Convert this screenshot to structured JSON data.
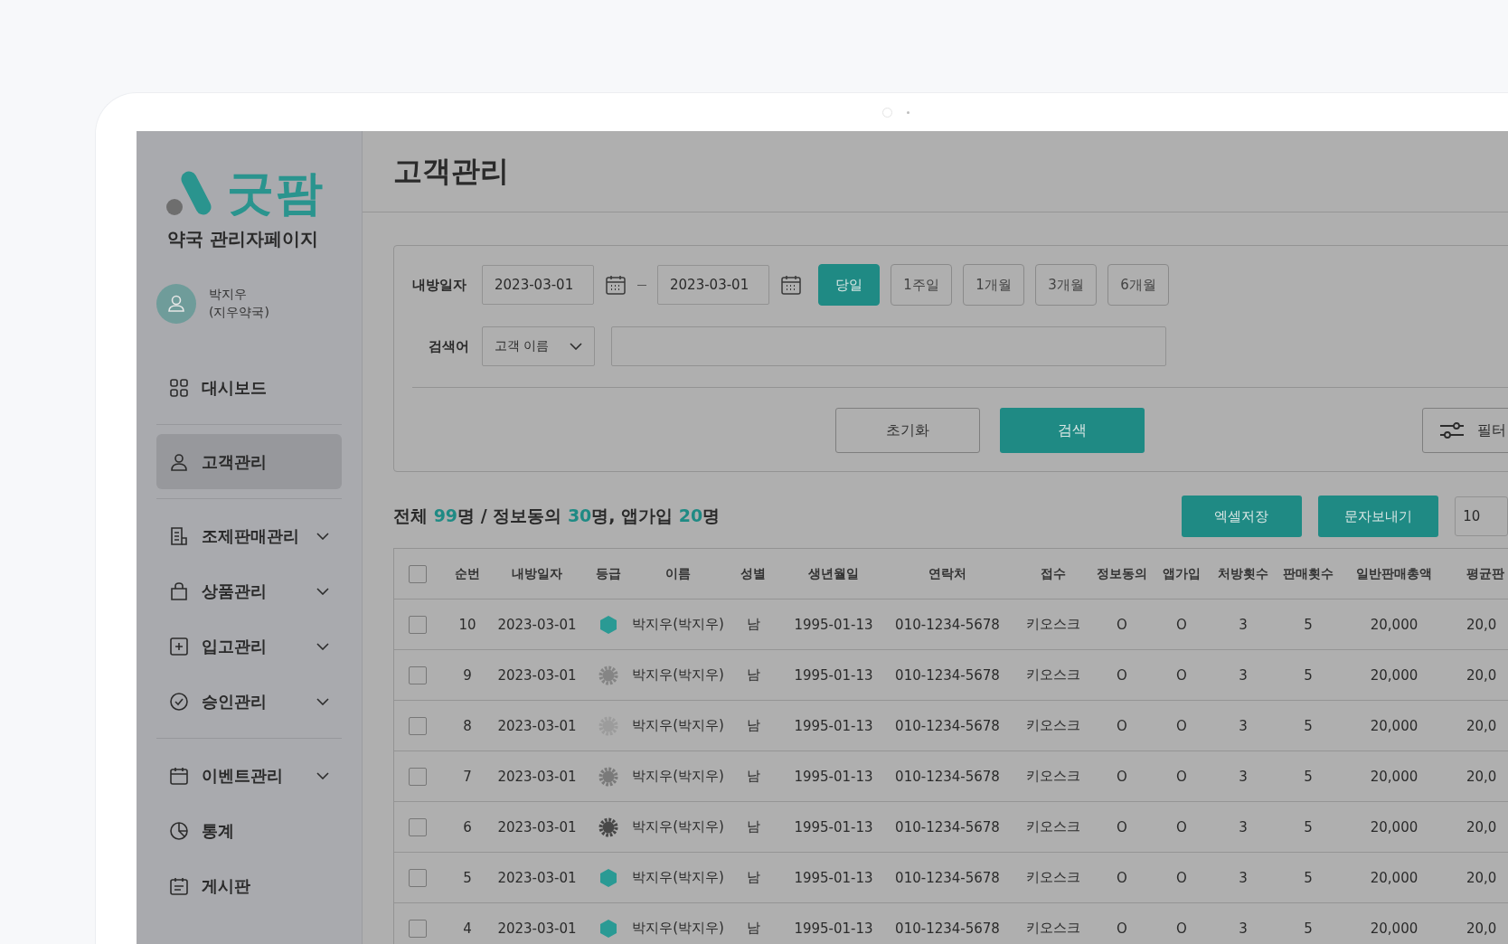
{
  "brand": {
    "name": "굿팜",
    "subtitle": "약국 관리자페이지"
  },
  "user": {
    "name": "박지우",
    "pharmacy": "(지우약국)"
  },
  "menu_groups": [
    {
      "items": [
        {
          "label": "대시보드",
          "kind": "grid",
          "selected": false,
          "expandable": false
        }
      ]
    },
    {
      "items": [
        {
          "label": "고객관리",
          "kind": "person",
          "selected": true,
          "expandable": false
        }
      ]
    },
    {
      "items": [
        {
          "label": "조제판매관리",
          "kind": "receipt",
          "selected": false,
          "expandable": true
        },
        {
          "label": "상품관리",
          "kind": "bag",
          "selected": false,
          "expandable": true
        },
        {
          "label": "입고관리",
          "kind": "plus-box",
          "selected": false,
          "expandable": true
        },
        {
          "label": "승인관리",
          "kind": "check-circle",
          "selected": false,
          "expandable": true
        }
      ]
    },
    {
      "items": [
        {
          "label": "이벤트관리",
          "kind": "calendar",
          "selected": false,
          "expandable": true
        },
        {
          "label": "통계",
          "kind": "pie",
          "selected": false,
          "expandable": false
        },
        {
          "label": "게시판",
          "kind": "board",
          "selected": false,
          "expandable": false
        }
      ]
    }
  ],
  "page_title": "고객관리",
  "filters": {
    "date_label": "내방일자",
    "date_from": "2023-03-01",
    "date_to": "2023-03-01",
    "periods": [
      {
        "label": "당일",
        "selected": true
      },
      {
        "label": "1주일",
        "selected": false
      },
      {
        "label": "1개월",
        "selected": false
      },
      {
        "label": "3개월",
        "selected": false
      },
      {
        "label": "6개월",
        "selected": false
      }
    ],
    "search_label": "검색어",
    "search_type": "고객 이름",
    "reset": "초기화",
    "search": "검색",
    "filter": "필터"
  },
  "summary": [
    {
      "text": "전체 ",
      "highlight": false
    },
    {
      "text": "99",
      "highlight": true
    },
    {
      "text": "명 / 정보동의 ",
      "highlight": false
    },
    {
      "text": "30",
      "highlight": true
    },
    {
      "text": "명, 앱가입 ",
      "highlight": false
    },
    {
      "text": "20",
      "highlight": true
    },
    {
      "text": "명",
      "highlight": false
    }
  ],
  "actions": [
    "엑셀저장",
    "문자보내기"
  ],
  "page_size": "10",
  "table": {
    "all_checked": false,
    "columns": [
      "순번",
      "내방일자",
      "등급",
      "이름",
      "성별",
      "생년월일",
      "연락처",
      "접수",
      "정보동의",
      "앱가입",
      "처방횟수",
      "판매횟수",
      "일반판매총액",
      "평균판"
    ],
    "rows": [
      {
        "checked": false,
        "cells": [
          "10",
          "2023-03-01",
          null,
          "박지우(박지우)",
          "남",
          "1995-01-13",
          "010-1234-5678",
          "키오스크",
          "O",
          "O",
          "3",
          "5",
          "20,000",
          "20,0"
        ],
        "grade": {
          "kind": "hexagon",
          "color": "#2a9a94"
        }
      },
      {
        "checked": false,
        "cells": [
          "9",
          "2023-03-01",
          null,
          "박지우(박지우)",
          "남",
          "1995-01-13",
          "010-1234-5678",
          "키오스크",
          "O",
          "O",
          "3",
          "5",
          "20,000",
          "20,0"
        ],
        "grade": {
          "kind": "gear",
          "color": "#858585"
        }
      },
      {
        "checked": false,
        "cells": [
          "8",
          "2023-03-01",
          null,
          "박지우(박지우)",
          "남",
          "1995-01-13",
          "010-1234-5678",
          "키오스크",
          "O",
          "O",
          "3",
          "5",
          "20,000",
          "20,0"
        ],
        "grade": {
          "kind": "gear",
          "color": "#9c9c9c"
        }
      },
      {
        "checked": false,
        "cells": [
          "7",
          "2023-03-01",
          null,
          "박지우(박지우)",
          "남",
          "1995-01-13",
          "010-1234-5678",
          "키오스크",
          "O",
          "O",
          "3",
          "5",
          "20,000",
          "20,0"
        ],
        "grade": {
          "kind": "gear",
          "color": "#7a7a7a"
        }
      },
      {
        "checked": false,
        "cells": [
          "6",
          "2023-03-01",
          null,
          "박지우(박지우)",
          "남",
          "1995-01-13",
          "010-1234-5678",
          "키오스크",
          "O",
          "O",
          "3",
          "5",
          "20,000",
          "20,0"
        ],
        "grade": {
          "kind": "gear",
          "color": "#484848"
        }
      },
      {
        "checked": false,
        "cells": [
          "5",
          "2023-03-01",
          null,
          "박지우(박지우)",
          "남",
          "1995-01-13",
          "010-1234-5678",
          "키오스크",
          "O",
          "O",
          "3",
          "5",
          "20,000",
          "20,0"
        ],
        "grade": {
          "kind": "hexagon",
          "color": "#2a9a94"
        }
      },
      {
        "checked": false,
        "cells": [
          "4",
          "2023-03-01",
          null,
          "박지우(박지우)",
          "남",
          "1995-01-13",
          "010-1234-5678",
          "키오스크",
          "O",
          "O",
          "3",
          "5",
          "20,000",
          "20,0"
        ],
        "grade": {
          "kind": "hexagon",
          "color": "#2a9a94"
        }
      }
    ]
  }
}
